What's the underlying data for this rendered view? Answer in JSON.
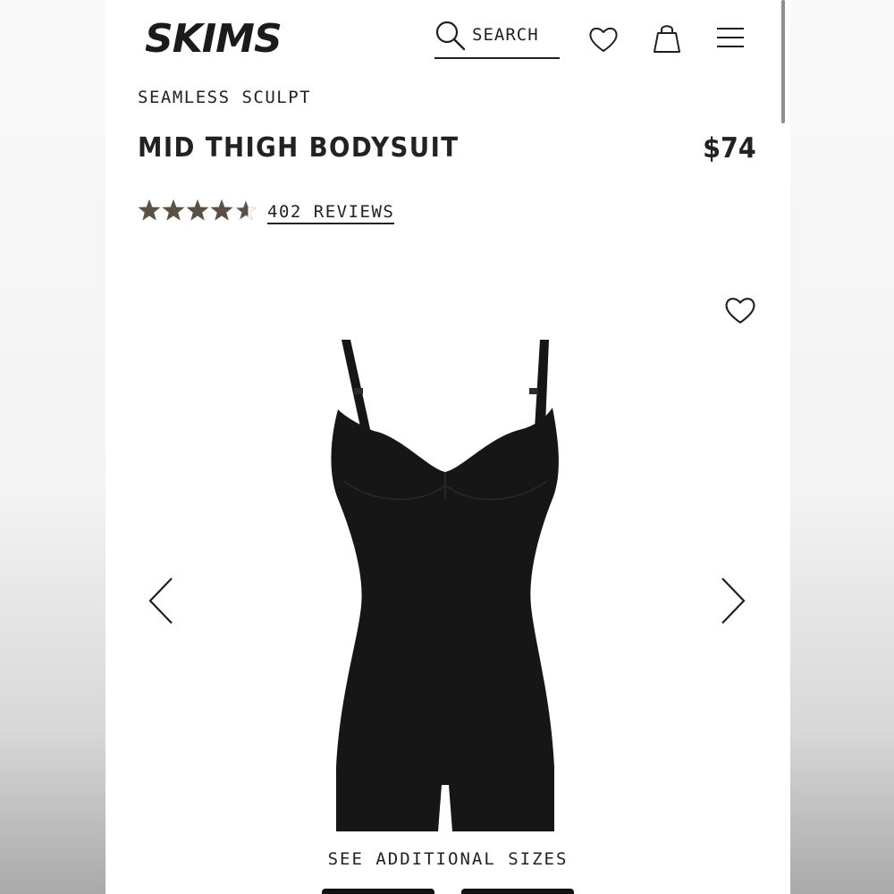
{
  "header": {
    "logo_text": "SKIMS",
    "search_label": "SEARCH",
    "icons": [
      "search-icon",
      "heart-icon",
      "shopping-bag-icon",
      "menu-icon"
    ]
  },
  "product": {
    "collection": "SEAMLESS SCULPT",
    "title": "MID THIGH BODYSUIT",
    "price": "$74",
    "rating": 4.6,
    "rating_max": 5,
    "reviews_label": "402 REVIEWS"
  },
  "gallery": {
    "icons": [
      "chevron-left-icon",
      "chevron-right-icon",
      "heart-icon"
    ],
    "see_sizes_label": "SEE ADDITIONAL SIZES"
  },
  "colors": {
    "text": "#222222",
    "star": "#5b5046",
    "garment": "#161616"
  }
}
